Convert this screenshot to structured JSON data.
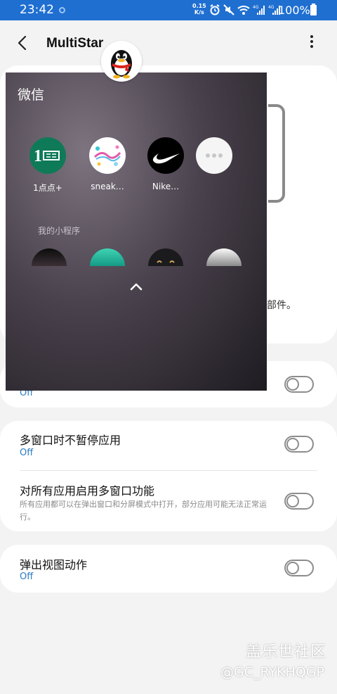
{
  "status_bar": {
    "time": "23:42",
    "speed_value": "0.15",
    "speed_unit": "K/s",
    "battery": "100%",
    "icons": [
      "alarm-icon",
      "mute-icon",
      "wifi-icon",
      "signal-4g-icon",
      "signal-4g-icon",
      "battery-icon"
    ]
  },
  "app_bar": {
    "title": "MultiStar"
  },
  "background_card": {
    "tail_text": "部件。"
  },
  "popup": {
    "title": "微信",
    "apps": [
      {
        "label": "1点点+",
        "icon": "1diandian-logo"
      },
      {
        "label": "sneak…",
        "icon": "sneaker-logo"
      },
      {
        "label": "Nike…",
        "icon": "nike-logo"
      },
      {
        "label": "",
        "icon": "more-icon"
      }
    ],
    "section_label": "我的小程序"
  },
  "settings": [
    {
      "title": "",
      "status": "Off",
      "toggle_on": false
    },
    {
      "title": "多窗口时不暂停应用",
      "status": "Off",
      "toggle_on": false
    },
    {
      "title": "对所有应用启用多窗口功能",
      "description": "所有应用都可以在弹出窗口和分屏模式中打开，部分应用可能无法正常运行。",
      "toggle_on": false
    },
    {
      "title": "弹出视图动作",
      "status": "Off",
      "toggle_on": false
    }
  ],
  "watermark": {
    "site": "盖乐世社区",
    "user": "@GC_RYKHQGP"
  },
  "colors": {
    "status_bar": "#1f6fd1",
    "accent": "#2a7bc4",
    "background": "#f3f3f3"
  }
}
